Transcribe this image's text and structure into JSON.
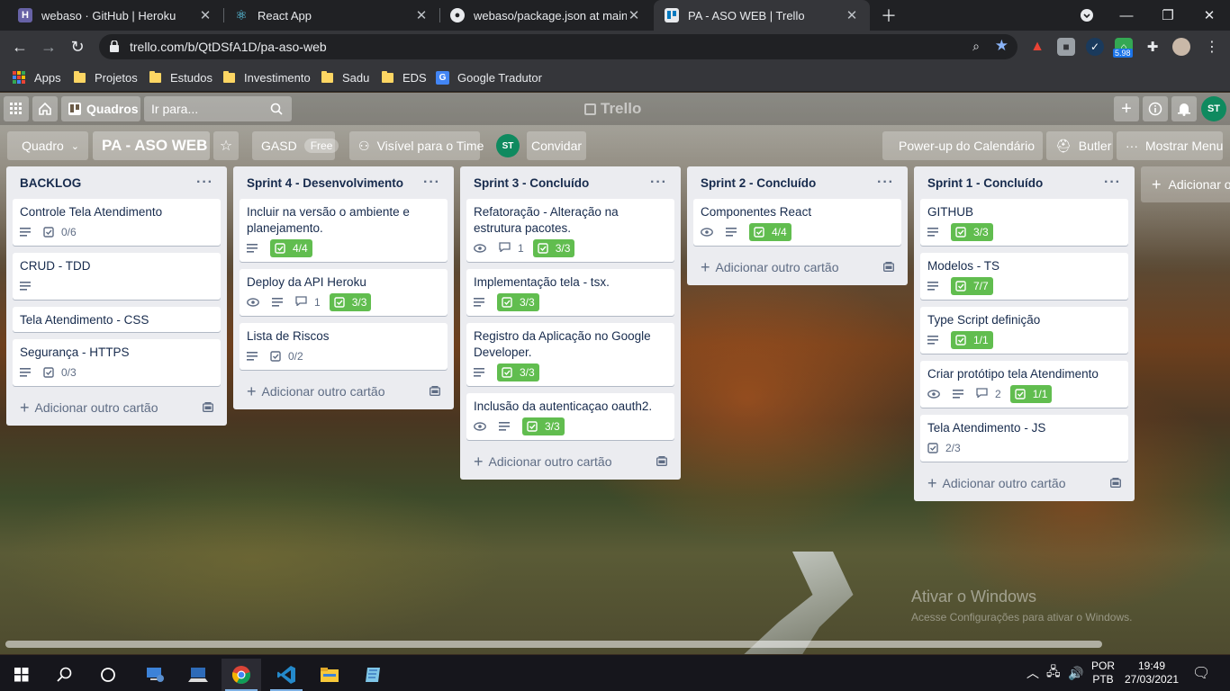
{
  "browser": {
    "tabs": [
      {
        "title": "webaso · GitHub | Heroku",
        "icon": "heroku-icon"
      },
      {
        "title": "React App",
        "icon": "react-icon"
      },
      {
        "title": "webaso/package.json at main · sa",
        "icon": "github-icon"
      },
      {
        "title": "PA - ASO WEB | Trello",
        "icon": "trello-icon"
      }
    ],
    "url": "trello.com/b/QtDSfA1D/pa-aso-web",
    "extension_badge": "5.98",
    "bookmarks": [
      "Apps",
      "Projetos",
      "Estudos",
      "Investimento",
      "Sadu",
      "EDS",
      "Google Tradutor"
    ]
  },
  "trello": {
    "boards_button": "Quadros",
    "search_placeholder": "Ir para...",
    "logo": "Trello",
    "user_initials": "ST",
    "board_view": "Quadro",
    "board_title": "PA - ASO WEB",
    "team": "GASD",
    "team_plan": "Free",
    "visibility": "Visível para o Time",
    "invite": "Convidar",
    "calendar_powerup": "Power-up do Calendário",
    "butler": "Butler",
    "show_menu": "Mostrar Menu",
    "add_card": "Adicionar outro cartão",
    "add_list": "Adicionar ou",
    "lists": [
      {
        "title": "BACKLOG",
        "cards": [
          {
            "title": "Controle Tela Atendimento",
            "desc": true,
            "checklist": "0/6",
            "done": false
          },
          {
            "title": "CRUD - TDD",
            "desc": true
          },
          {
            "title": "Tela Atendimento - CSS"
          },
          {
            "title": "Segurança - HTTPS",
            "desc": true,
            "checklist": "0/3",
            "done": false
          }
        ]
      },
      {
        "title": "Sprint 4 - Desenvolvimento",
        "cards": [
          {
            "title": "Incluir na versão o ambiente e planejamento.",
            "desc": true,
            "checklist": "4/4",
            "done": true
          },
          {
            "title": "Deploy da API Heroku",
            "watch": true,
            "desc": true,
            "comments": "1",
            "checklist": "3/3",
            "done": true
          },
          {
            "title": "Lista de Riscos",
            "desc": true,
            "checklist": "0/2",
            "done": false
          }
        ]
      },
      {
        "title": "Sprint 3 - Concluído",
        "cards": [
          {
            "title": "Refatoração - Alteração na estrutura pacotes.",
            "watch": true,
            "comments": "1",
            "checklist": "3/3",
            "done": true
          },
          {
            "title": "Implementação tela - tsx.",
            "desc": true,
            "checklist": "3/3",
            "done": true
          },
          {
            "title": "Registro da Aplicação no Google Developer.",
            "desc": true,
            "checklist": "3/3",
            "done": true
          },
          {
            "title": "Inclusão da autenticaçao oauth2.",
            "watch": true,
            "desc": true,
            "checklist": "3/3",
            "done": true
          }
        ]
      },
      {
        "title": "Sprint 2 - Concluído",
        "cards": [
          {
            "title": "Componentes React",
            "watch": true,
            "desc": true,
            "checklist": "4/4",
            "done": true
          }
        ]
      },
      {
        "title": "Sprint 1 - Concluído",
        "cards": [
          {
            "title": "GITHUB",
            "desc": true,
            "checklist": "3/3",
            "done": true
          },
          {
            "title": "Modelos - TS",
            "desc": true,
            "checklist": "7/7",
            "done": true
          },
          {
            "title": "Type Script definição",
            "desc": true,
            "checklist": "1/1",
            "done": true
          },
          {
            "title": "Criar protótipo tela Atendimento",
            "watch": true,
            "desc": true,
            "comments": "2",
            "checklist": "1/1",
            "done": true
          },
          {
            "title": "Tela Atendimento - JS",
            "checklist": "2/3",
            "done": false
          }
        ]
      }
    ],
    "watermark_title": "Ativar o Windows",
    "watermark_sub": "Acesse Configurações para ativar o Windows."
  },
  "taskbar": {
    "lang": "POR",
    "layout": "PTB",
    "time": "19:49",
    "date": "27/03/2021"
  },
  "colors": {
    "trello_green": "#61bd4f",
    "list_bg": "#ebecf0",
    "chrome_dark": "#202124",
    "avatar": "#0f8a5f"
  }
}
